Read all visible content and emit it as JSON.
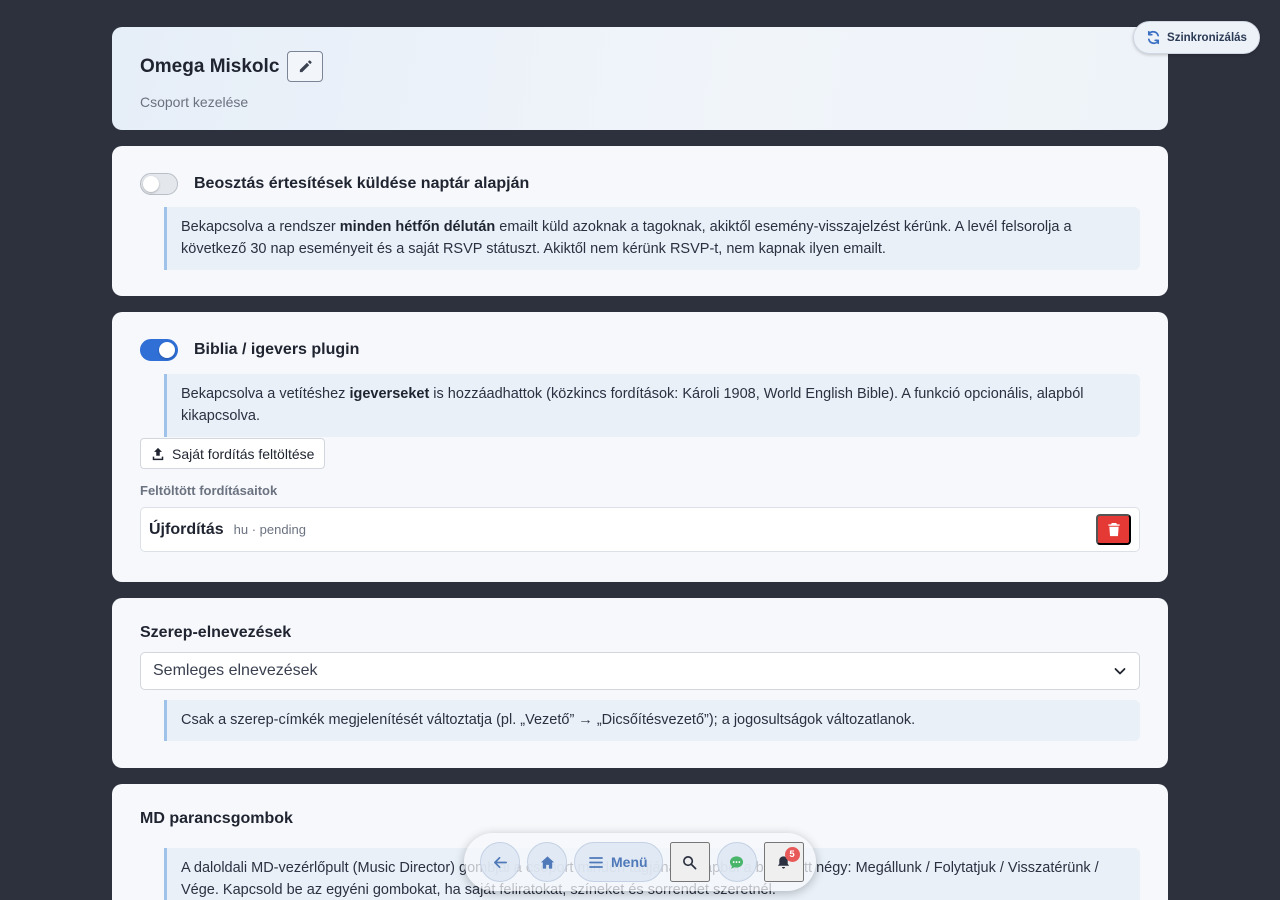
{
  "header": {
    "group_name": "Omega Miskolc",
    "subtitle": "Csoport kezelése"
  },
  "sync_button": {
    "label": "Szinkronizálás"
  },
  "schedule_notifications": {
    "enabled": false,
    "label": "Beosztás értesítések küldése naptár alapján",
    "info": {
      "before": "Bekapcsolva a rendszer ",
      "bold": "minden hétfőn délután",
      "after": " emailt küld azoknak a tagoknak, akiktől esemény-visszajelzést kérünk. A levél felsorolja a következő 30 nap eseményeit és a saját RSVP státuszt. Akiktől nem kérünk RSVP-t, nem kapnak ilyen emailt."
    }
  },
  "bible_plugin": {
    "enabled": true,
    "label": "Biblia / igevers plugin",
    "info": {
      "before": "Bekapcsolva a vetítéshez ",
      "bold": "igeverseket",
      "after": " is hozzáadhattok (közkincs fordítások: Károli 1908, World English Bible). A funkció opcionális, alapból kikapcsolva."
    },
    "upload_label": "Saját fordítás feltöltése",
    "uploaded_label": "Feltöltött fordításaitok",
    "translations": [
      {
        "name": "Újfordítás",
        "meta": "hu · pending"
      }
    ]
  },
  "role_names": {
    "title": "Szerep-elnevezések",
    "selected": "Semleges elnevezések",
    "info": "Csak a szerep-címkék megjelenítését változtatja (pl. „Vezető” → „Dicsőítésvezető”); a jogosultságok változatlanok."
  },
  "md_buttons": {
    "title": "MD parancsgombok",
    "info": "A daloldali MD-vezérlőpult (Music Director) gombjai a csoport minden tagjának. Alapból a beépített négy: Megállunk / Folytatjuk / Visszatérünk / Vége. Kapcsold be az egyéni gombokat, ha saját feliratokat, színeket és sorrendet szeretnél."
  },
  "bottom_nav": {
    "menu_label": "Menü",
    "notification_count": "5"
  },
  "colors": {
    "background": "#2d313d",
    "card": "#f6f8fb",
    "accent": "#2f6fd6",
    "danger": "#e53935",
    "info_border": "#9ec2ea"
  },
  "icons": [
    "pencil-icon",
    "sync-icon",
    "upload-icon",
    "trash-icon",
    "chevron-down-icon",
    "arrow-left-icon",
    "home-icon",
    "menu-icon",
    "search-icon",
    "chat-icon",
    "bell-icon"
  ]
}
